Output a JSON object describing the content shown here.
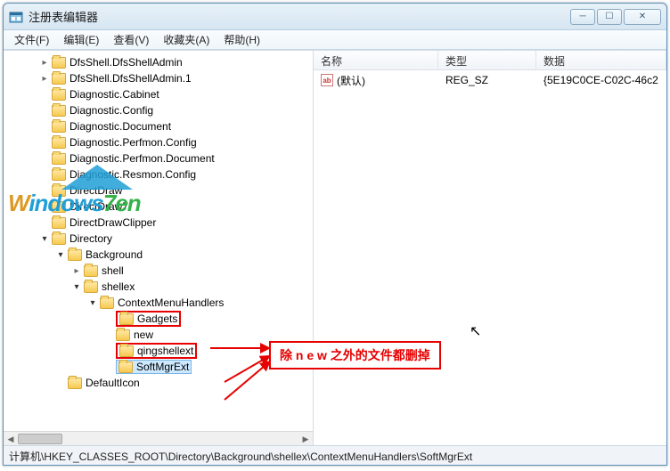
{
  "window": {
    "title": "注册表编辑器"
  },
  "winbuttons": {
    "min": "─",
    "max": "☐",
    "close": "✕"
  },
  "menu": [
    "文件(F)",
    "编辑(E)",
    "查看(V)",
    "收藏夹(A)",
    "帮助(H)"
  ],
  "tree": [
    {
      "depth": 2,
      "chev": "right",
      "label": "DfsShell.DfsShellAdmin"
    },
    {
      "depth": 2,
      "chev": "right",
      "label": "DfsShell.DfsShellAdmin.1"
    },
    {
      "depth": 2,
      "chev": "none",
      "label": "Diagnostic.Cabinet"
    },
    {
      "depth": 2,
      "chev": "none",
      "label": "Diagnostic.Config"
    },
    {
      "depth": 2,
      "chev": "none",
      "label": "Diagnostic.Document"
    },
    {
      "depth": 2,
      "chev": "none",
      "label": "Diagnostic.Perfmon.Config"
    },
    {
      "depth": 2,
      "chev": "none",
      "label": "Diagnostic.Perfmon.Document"
    },
    {
      "depth": 2,
      "chev": "none",
      "label": "Diagnostic.Resmon.Config"
    },
    {
      "depth": 2,
      "chev": "none",
      "label": "DirectDraw"
    },
    {
      "depth": 2,
      "chev": "none",
      "label": "DirectDraw7"
    },
    {
      "depth": 2,
      "chev": "none",
      "label": "DirectDrawClipper"
    },
    {
      "depth": 2,
      "chev": "down",
      "label": "Directory"
    },
    {
      "depth": 3,
      "chev": "down",
      "label": "Background"
    },
    {
      "depth": 4,
      "chev": "right",
      "label": "shell"
    },
    {
      "depth": 4,
      "chev": "down",
      "label": "shellex"
    },
    {
      "depth": 5,
      "chev": "down",
      "label": "ContextMenuHandlers"
    },
    {
      "depth": 6,
      "chev": "none",
      "label": "Gadgets",
      "red": true
    },
    {
      "depth": 6,
      "chev": "none",
      "label": "new"
    },
    {
      "depth": 6,
      "chev": "none",
      "label": "qingshellext",
      "red": true
    },
    {
      "depth": 6,
      "chev": "none",
      "label": "SoftMgrExt",
      "red": true,
      "selected": true
    },
    {
      "depth": 3,
      "chev": "none",
      "label": "DefaultIcon"
    }
  ],
  "list": {
    "columns": [
      "名称",
      "类型",
      "数据"
    ],
    "rows": [
      {
        "name": "(默认)",
        "type": "REG_SZ",
        "data": "{5E19C0CE-C02C-46c2"
      }
    ]
  },
  "annotation": {
    "text": "除 n e w 之外的文件都删掉"
  },
  "statusbar": "计算机\\HKEY_CLASSES_ROOT\\Directory\\Background\\shellex\\ContextMenuHandlers\\SoftMgrExt",
  "watermark": {
    "line1a": "W",
    "line1b": "indows",
    "line1c": "7en",
    "sub": "· · · · · · · · ·"
  }
}
